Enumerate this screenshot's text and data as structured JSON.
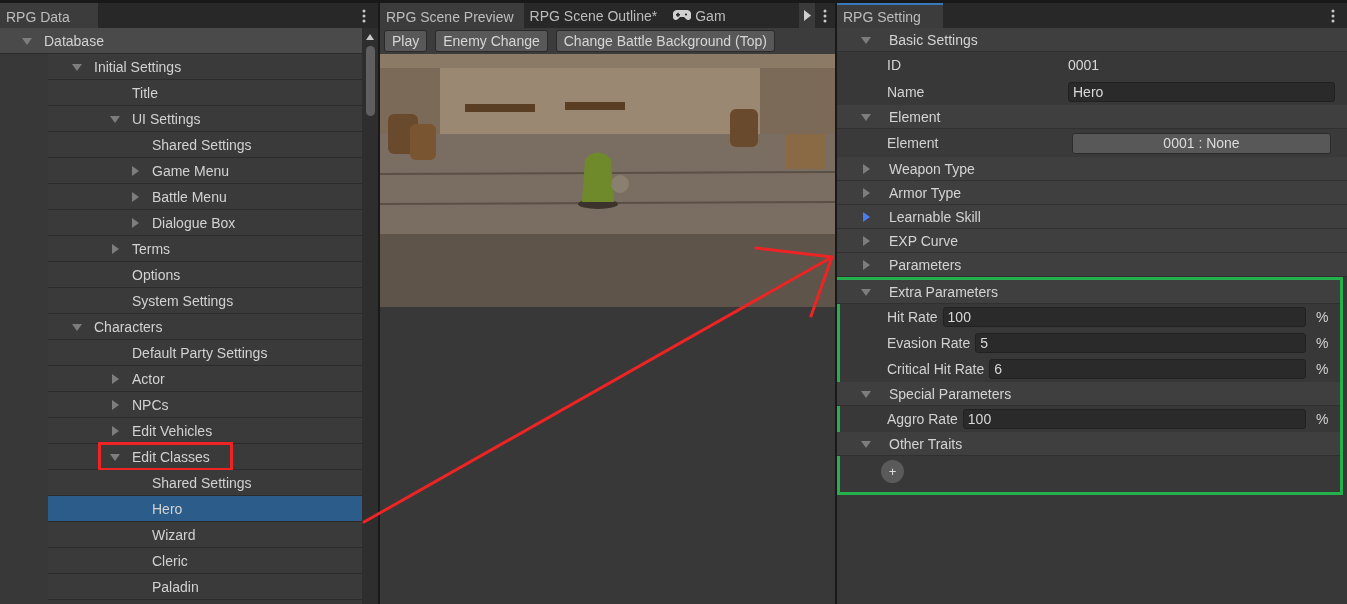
{
  "left_panel": {
    "tab": {
      "label": "RPG Data",
      "selected": true
    },
    "tree": [
      {
        "label": "Database",
        "kind": "group",
        "expanded": true,
        "selected": false,
        "marked": false,
        "children": [
          {
            "label": "Initial Settings",
            "kind": "group",
            "expanded": true,
            "selected": false,
            "marked": false,
            "children": [
              {
                "label": "Title",
                "kind": "leaf",
                "selected": false,
                "marked": false
              },
              {
                "label": "UI Settings",
                "kind": "group",
                "expanded": true,
                "selected": false,
                "marked": false,
                "children": [
                  {
                    "label": "Shared Settings",
                    "kind": "leaf",
                    "selected": false,
                    "marked": false
                  },
                  {
                    "label": "Game Menu",
                    "kind": "group",
                    "expanded": false,
                    "selected": false,
                    "marked": false
                  },
                  {
                    "label": "Battle Menu",
                    "kind": "group",
                    "expanded": false,
                    "selected": false,
                    "marked": false
                  },
                  {
                    "label": "Dialogue Box",
                    "kind": "group",
                    "expanded": false,
                    "selected": false,
                    "marked": false
                  }
                ]
              },
              {
                "label": "Terms",
                "kind": "group",
                "expanded": false,
                "selected": false,
                "marked": false
              },
              {
                "label": "Options",
                "kind": "leaf",
                "selected": false,
                "marked": false
              },
              {
                "label": "System Settings",
                "kind": "leaf",
                "selected": false,
                "marked": false
              }
            ]
          },
          {
            "label": "Characters",
            "kind": "group",
            "expanded": true,
            "selected": false,
            "marked": false,
            "children": [
              {
                "label": "Default Party Settings",
                "kind": "leaf",
                "selected": false,
                "marked": false
              },
              {
                "label": "Actor",
                "kind": "group",
                "expanded": false,
                "selected": false,
                "marked": false
              },
              {
                "label": "NPCs",
                "kind": "group",
                "expanded": false,
                "selected": false,
                "marked": false
              },
              {
                "label": "Edit Vehicles",
                "kind": "group",
                "expanded": false,
                "selected": false,
                "marked": false
              },
              {
                "label": "Edit Classes",
                "kind": "group",
                "expanded": true,
                "selected": false,
                "marked": true,
                "children": [
                  {
                    "label": "Shared Settings",
                    "kind": "leaf",
                    "selected": false,
                    "marked": false
                  },
                  {
                    "label": "Hero",
                    "kind": "leaf",
                    "selected": true,
                    "marked": false
                  },
                  {
                    "label": "Wizard",
                    "kind": "leaf",
                    "selected": false,
                    "marked": false
                  },
                  {
                    "label": "Cleric",
                    "kind": "leaf",
                    "selected": false,
                    "marked": false
                  },
                  {
                    "label": "Paladin",
                    "kind": "leaf",
                    "selected": false,
                    "marked": false
                  }
                ]
              }
            ]
          }
        ]
      }
    ]
  },
  "middle_panel": {
    "tabs": [
      {
        "label": "RPG Scene Preview",
        "kind": "plain",
        "selected": true
      },
      {
        "label": "RPG Scene Outline*",
        "kind": "plain",
        "selected": false
      },
      {
        "label": "Gam",
        "kind": "game",
        "selected": false
      }
    ],
    "toolbar": [
      "Play",
      "Enemy Change",
      "Change Battle Background (Top)"
    ],
    "preview": {
      "kind": "picture"
    }
  },
  "right_panel": {
    "tab": {
      "label": "RPG Setting",
      "selected": true
    },
    "sections": [
      {
        "title": "Basic Settings",
        "expanded": true,
        "focused": false,
        "boxed": false,
        "fields": [
          {
            "kind": "readonly",
            "label": "ID",
            "value": "0001"
          },
          {
            "kind": "text",
            "label": "Name",
            "value": "Hero"
          }
        ]
      },
      {
        "title": "Element",
        "expanded": true,
        "focused": false,
        "boxed": false,
        "fields": [
          {
            "kind": "dropdown",
            "label": "Element",
            "value": "0001 : None"
          }
        ]
      },
      {
        "title": "Weapon Type",
        "expanded": false,
        "focused": false,
        "boxed": false
      },
      {
        "title": "Armor Type",
        "expanded": false,
        "focused": false,
        "boxed": false
      },
      {
        "title": "Learnable Skill",
        "expanded": false,
        "focused": true,
        "boxed": false
      },
      {
        "title": "EXP Curve",
        "expanded": false,
        "focused": false,
        "boxed": false
      },
      {
        "title": "Parameters",
        "expanded": false,
        "focused": false,
        "boxed": false
      },
      {
        "title": "Extra Parameters",
        "expanded": true,
        "focused": false,
        "boxed": true,
        "fields": [
          {
            "kind": "percent",
            "label": "Hit Rate",
            "value": "100",
            "unit": "%"
          },
          {
            "kind": "percent",
            "label": "Evasion Rate",
            "value": "5",
            "unit": "%"
          },
          {
            "kind": "percent",
            "label": "Critical Hit Rate",
            "value": "6",
            "unit": "%"
          }
        ]
      },
      {
        "title": "Special Parameters",
        "expanded": true,
        "focused": false,
        "boxed": true,
        "fields": [
          {
            "kind": "percent",
            "label": "Aggro Rate",
            "value": "100",
            "unit": "%"
          }
        ]
      },
      {
        "title": "Other Traits",
        "expanded": true,
        "focused": false,
        "boxed": true,
        "fields": [
          {
            "kind": "add",
            "label": "+"
          }
        ]
      }
    ]
  }
}
